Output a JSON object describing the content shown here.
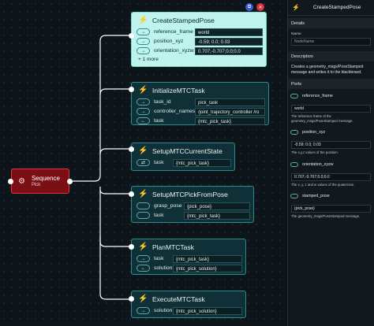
{
  "sequence": {
    "title": "Sequence",
    "subtitle": "Pick",
    "icon": "gears-icon"
  },
  "nodes": {
    "create": {
      "title": "CreateStampedPose",
      "ports": [
        {
          "direction": "in",
          "glyph": "→",
          "name": "reference_frame",
          "value": "world"
        },
        {
          "direction": "in",
          "glyph": "→",
          "name": "position_xyz",
          "value": "-0.59; 0.0; 0.03"
        },
        {
          "direction": "in",
          "glyph": "→",
          "name": "orientation_xyzw",
          "value": "0.707;-0.707;0.0;0.0"
        }
      ],
      "more": "+ 1 more"
    },
    "init": {
      "title": "InitializeMTCTask",
      "ports": [
        {
          "direction": "in",
          "glyph": "→",
          "name": "task_id",
          "value": "pick_task"
        },
        {
          "direction": "in",
          "glyph": "→",
          "name": "controller_names",
          "value": "/joint_trajectory_controller /ro"
        },
        {
          "direction": "out",
          "glyph": "←",
          "name": "task",
          "value": "{mtc_pick_task}"
        }
      ]
    },
    "current": {
      "title": "SetupMTCCurrentState",
      "ports": [
        {
          "direction": "inout",
          "glyph": "⇄",
          "name": "task",
          "value": "{mtc_pick_task}"
        }
      ]
    },
    "pickfrom": {
      "title": "SetupMTCPickFromPose",
      "ports": [
        {
          "direction": "none",
          "glyph": "",
          "name": "grasp_pose",
          "value": "{pick_pose}"
        },
        {
          "direction": "none",
          "glyph": "",
          "name": "task",
          "value": "{mtc_pick_task}"
        }
      ]
    },
    "plan": {
      "title": "PlanMTCTask",
      "ports": [
        {
          "direction": "in",
          "glyph": "→",
          "name": "task",
          "value": "{mtc_pick_task}"
        },
        {
          "direction": "out",
          "glyph": "←",
          "name": "solution",
          "value": "{mtc_pick_solution}"
        }
      ]
    },
    "execute": {
      "title": "ExecuteMTCTask",
      "ports": [
        {
          "direction": "in",
          "glyph": "→",
          "name": "solution",
          "value": "{mtc_pick_solution}"
        }
      ]
    }
  },
  "sidebar": {
    "title": "CreateStampedPose",
    "details_label": "Details",
    "name_label": "Name",
    "name_placeholder": "NodeName",
    "description_label": "Description",
    "description_text": "Creates a geometry_msgs/PoseStamped message and writes it to the blackboard.",
    "ports_label": "Ports",
    "ports": [
      {
        "name": "reference_frame",
        "value": "world",
        "description": "The reference frame of the geometry_msgs/PoseStamped message."
      },
      {
        "name": "position_xyz",
        "value": "-0.59; 0.0; 0.03",
        "description": "The x,y,z values of the position."
      },
      {
        "name": "orientation_xyzw",
        "value": "0.707;-0.707;0.0;0.0",
        "description": "The x, y, z and w values of the quaternion."
      },
      {
        "name": "stamped_pose",
        "value": "{pick_pose}",
        "description": "The geometry_msgs/PoseStamped message."
      }
    ]
  },
  "colors": {
    "accent": "#2f8c8c",
    "sequence": "#7a1016",
    "selected_node": "#bff3ee"
  }
}
